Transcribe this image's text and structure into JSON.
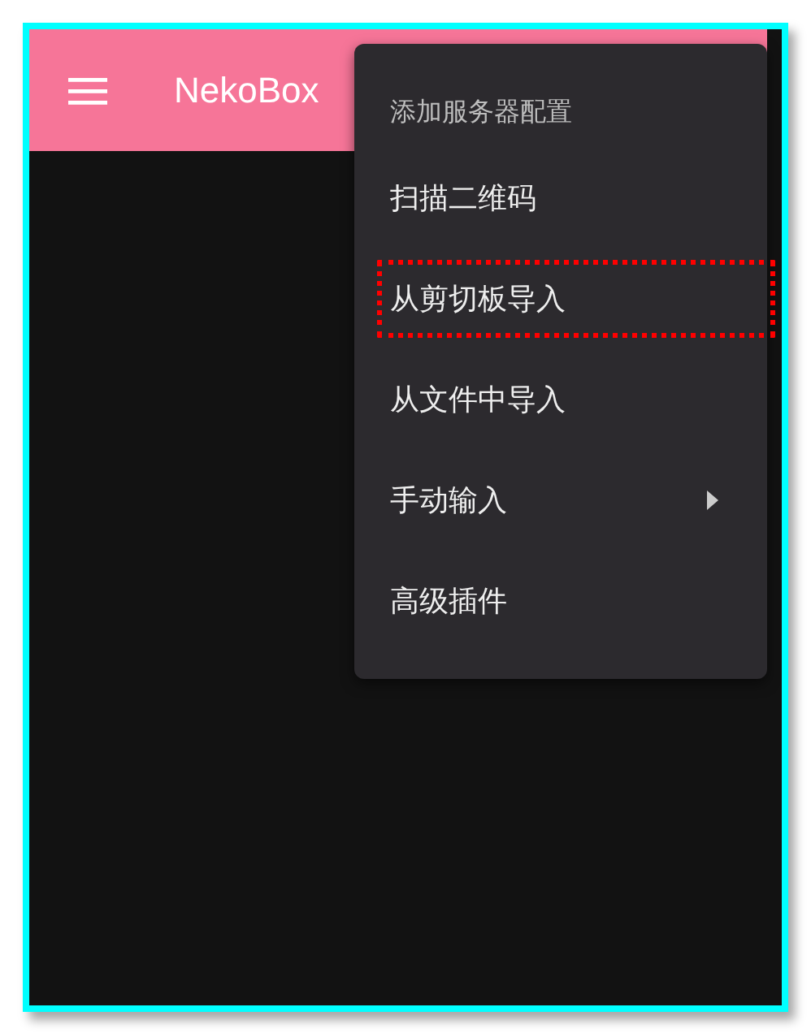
{
  "app_bar": {
    "title": "NekoBox"
  },
  "menu": {
    "header": "添加服务器配置",
    "items": [
      {
        "label": "扫描二维码",
        "has_submenu": false,
        "highlighted": false
      },
      {
        "label": "从剪切板导入",
        "has_submenu": false,
        "highlighted": true
      },
      {
        "label": "从文件中导入",
        "has_submenu": false,
        "highlighted": false
      },
      {
        "label": "手动输入",
        "has_submenu": true,
        "highlighted": false
      },
      {
        "label": "高级插件",
        "has_submenu": false,
        "highlighted": false
      }
    ]
  }
}
